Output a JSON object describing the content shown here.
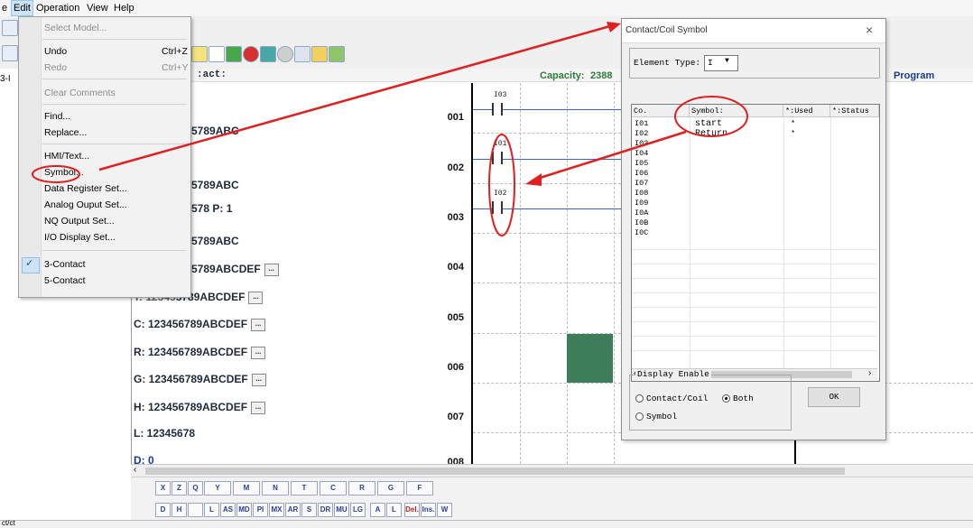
{
  "menubar": {
    "items": [
      "e",
      "Edit",
      "Operation",
      "View",
      "Help"
    ]
  },
  "edit_menu": {
    "items": [
      {
        "label": "Select Model...",
        "shortcut": "",
        "disabled": false
      },
      {
        "label": "Undo",
        "shortcut": "Ctrl+Z",
        "disabled": false
      },
      {
        "label": "Redo",
        "shortcut": "Ctrl+Y",
        "disabled": true
      },
      {
        "label": "Clear Comments",
        "shortcut": "",
        "disabled": true
      },
      {
        "label": "Find...",
        "shortcut": "",
        "disabled": false
      },
      {
        "label": "Replace...",
        "shortcut": "",
        "disabled": false
      },
      {
        "label": "HMI/Text...",
        "shortcut": "",
        "disabled": false
      },
      {
        "label": "Symbol...",
        "shortcut": "",
        "disabled": false
      },
      {
        "label": "Data Register Set...",
        "shortcut": "",
        "disabled": false
      },
      {
        "label": "Analog Ouput Set...",
        "shortcut": "",
        "disabled": false
      },
      {
        "label": "NQ Output Set...",
        "shortcut": "",
        "disabled": false
      },
      {
        "label": "I/O Display Set...",
        "shortcut": "",
        "disabled": false
      },
      {
        "label": "3-Contact",
        "shortcut": "",
        "disabled": false,
        "checked": true
      },
      {
        "label": "5-Contact",
        "shortcut": "",
        "disabled": false
      }
    ]
  },
  "editor": {
    "header_left": ":act:",
    "capacity_label": "Capacity:",
    "capacity_value": "2388",
    "program_label": "Program",
    "left_partial": "3-I"
  },
  "element_lines": [
    {
      "text": "5789ABC"
    },
    {
      "text": "5789ABC"
    },
    {
      "text": "578  P: 1"
    },
    {
      "text": "5789ABC"
    },
    {
      "text": "5789ABCDEF"
    },
    {
      "text": "5789ABCDEF"
    },
    {
      "text": "C: 123456789ABCDEF"
    },
    {
      "text": "R: 123456789ABCDEF"
    },
    {
      "text": "G: 123456789ABCDEF"
    },
    {
      "text": "H: 123456789ABCDEF"
    },
    {
      "text": "L: 12345678"
    },
    {
      "text": "D:  0"
    }
  ],
  "line_partial_prefix": "T: 12345",
  "bubble_text": "...",
  "rows": [
    "001",
    "002",
    "003",
    "004",
    "005",
    "006",
    "007",
    "008"
  ],
  "contacts": [
    "I03",
    "I01",
    "I02"
  ],
  "dialog": {
    "title": "Contact/Coil Symbol",
    "close": "×",
    "element_type_label": "Element Type:",
    "element_type_value": "I",
    "columns": [
      "Co.",
      "Symbol:",
      "*:Used",
      "*:Status"
    ],
    "rows": [
      {
        "code": "I01",
        "symbol": "start",
        "used": "*"
      },
      {
        "code": "I02",
        "symbol": "Return",
        "used": "*"
      },
      {
        "code": "I03",
        "symbol": "",
        "used": ""
      },
      {
        "code": "I04",
        "symbol": "",
        "used": ""
      },
      {
        "code": "I05",
        "symbol": "",
        "used": ""
      },
      {
        "code": "I06",
        "symbol": "",
        "used": ""
      },
      {
        "code": "I07",
        "symbol": "",
        "used": ""
      },
      {
        "code": "I08",
        "symbol": "",
        "used": ""
      },
      {
        "code": "I09",
        "symbol": "",
        "used": ""
      },
      {
        "code": "I0A",
        "symbol": "",
        "used": ""
      },
      {
        "code": "I0B",
        "symbol": "",
        "used": ""
      },
      {
        "code": "I0C",
        "symbol": "",
        "used": ""
      }
    ],
    "display_enable_label": "Display Enable",
    "radio_contact_coil": "Contact/Coil",
    "radio_both": "Both",
    "radio_symbol": "Symbol",
    "ok_label": "OK"
  },
  "palette_row1": [
    "X",
    "Z",
    "Q",
    "Y",
    "M",
    "N",
    "T",
    "C",
    "R",
    "G",
    "F"
  ],
  "palette_row2": [
    "D",
    "H",
    "",
    "L",
    "AS",
    "MD",
    "PI",
    "MX",
    "AR",
    "S",
    "DR",
    "MU",
    "LG",
    "A",
    "L",
    "Del.",
    "Ins.",
    "W"
  ],
  "statusbar": {
    "text": "ct/ct"
  },
  "colors": {
    "accent_red": "#e02020",
    "ladder_blue": "#3a62d0",
    "capacity_green": "#2f7d3a",
    "block_green": "#3d7d5a"
  }
}
